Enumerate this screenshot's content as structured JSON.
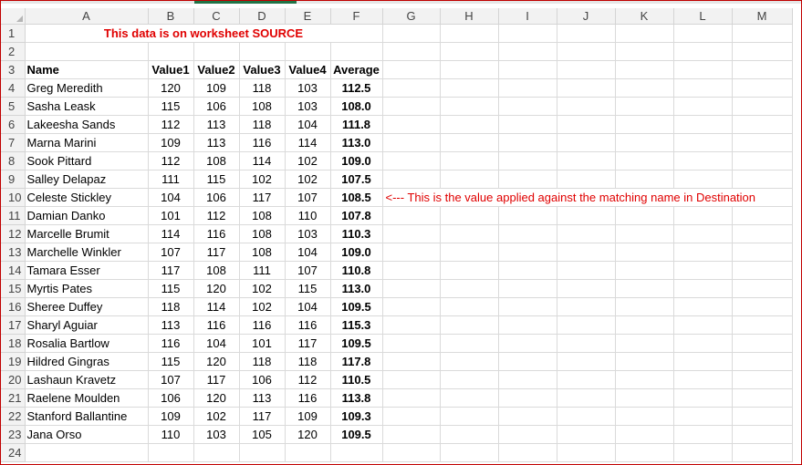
{
  "columns": [
    "A",
    "B",
    "C",
    "D",
    "E",
    "F",
    "G",
    "H",
    "I",
    "J",
    "K",
    "L",
    "M"
  ],
  "title": "This data is on worksheet SOURCE",
  "headers": {
    "name": "Name",
    "v1": "Value1",
    "v2": "Value2",
    "v3": "Value3",
    "v4": "Value4",
    "avg": "Average"
  },
  "annotation": "<--- This is the value applied against the matching name in Destination",
  "row_numbers": [
    "1",
    "2",
    "3",
    "4",
    "5",
    "6",
    "7",
    "8",
    "9",
    "10",
    "11",
    "12",
    "13",
    "14",
    "15",
    "16",
    "17",
    "18",
    "19",
    "20",
    "21",
    "22",
    "23",
    "24"
  ],
  "rows": [
    {
      "name": "Greg Meredith",
      "v1": "120",
      "v2": "109",
      "v3": "118",
      "v4": "103",
      "avg": "112.5"
    },
    {
      "name": "Sasha Leask",
      "v1": "115",
      "v2": "106",
      "v3": "108",
      "v4": "103",
      "avg": "108.0"
    },
    {
      "name": "Lakeesha Sands",
      "v1": "112",
      "v2": "113",
      "v3": "118",
      "v4": "104",
      "avg": "111.8"
    },
    {
      "name": "Marna Marini",
      "v1": "109",
      "v2": "113",
      "v3": "116",
      "v4": "114",
      "avg": "113.0"
    },
    {
      "name": "Sook Pittard",
      "v1": "112",
      "v2": "108",
      "v3": "114",
      "v4": "102",
      "avg": "109.0"
    },
    {
      "name": "Salley Delapaz",
      "v1": "111",
      "v2": "115",
      "v3": "102",
      "v4": "102",
      "avg": "107.5"
    },
    {
      "name": "Celeste Stickley",
      "v1": "104",
      "v2": "106",
      "v3": "117",
      "v4": "107",
      "avg": "108.5"
    },
    {
      "name": "Damian Danko",
      "v1": "101",
      "v2": "112",
      "v3": "108",
      "v4": "110",
      "avg": "107.8"
    },
    {
      "name": "Marcelle Brumit",
      "v1": "114",
      "v2": "116",
      "v3": "108",
      "v4": "103",
      "avg": "110.3"
    },
    {
      "name": "Marchelle Winkler",
      "v1": "107",
      "v2": "117",
      "v3": "108",
      "v4": "104",
      "avg": "109.0"
    },
    {
      "name": "Tamara Esser",
      "v1": "117",
      "v2": "108",
      "v3": "111",
      "v4": "107",
      "avg": "110.8"
    },
    {
      "name": "Myrtis Pates",
      "v1": "115",
      "v2": "120",
      "v3": "102",
      "v4": "115",
      "avg": "113.0"
    },
    {
      "name": "Sheree Duffey",
      "v1": "118",
      "v2": "114",
      "v3": "102",
      "v4": "104",
      "avg": "109.5"
    },
    {
      "name": "Sharyl Aguiar",
      "v1": "113",
      "v2": "116",
      "v3": "116",
      "v4": "116",
      "avg": "115.3"
    },
    {
      "name": "Rosalia Bartlow",
      "v1": "116",
      "v2": "104",
      "v3": "101",
      "v4": "117",
      "avg": "109.5"
    },
    {
      "name": "Hildred Gingras",
      "v1": "115",
      "v2": "120",
      "v3": "118",
      "v4": "118",
      "avg": "117.8"
    },
    {
      "name": "Lashaun Kravetz",
      "v1": "107",
      "v2": "117",
      "v3": "106",
      "v4": "112",
      "avg": "110.5"
    },
    {
      "name": "Raelene Moulden",
      "v1": "106",
      "v2": "120",
      "v3": "113",
      "v4": "116",
      "avg": "113.8"
    },
    {
      "name": "Stanford Ballantine",
      "v1": "109",
      "v2": "102",
      "v3": "117",
      "v4": "109",
      "avg": "109.3"
    },
    {
      "name": "Jana Orso",
      "v1": "110",
      "v2": "103",
      "v3": "105",
      "v4": "120",
      "avg": "109.5"
    }
  ],
  "colors": {
    "accent_red": "#e00000",
    "border_red": "#c00000",
    "header_bg": "#f2f2f2",
    "tab_green": "#217346"
  }
}
